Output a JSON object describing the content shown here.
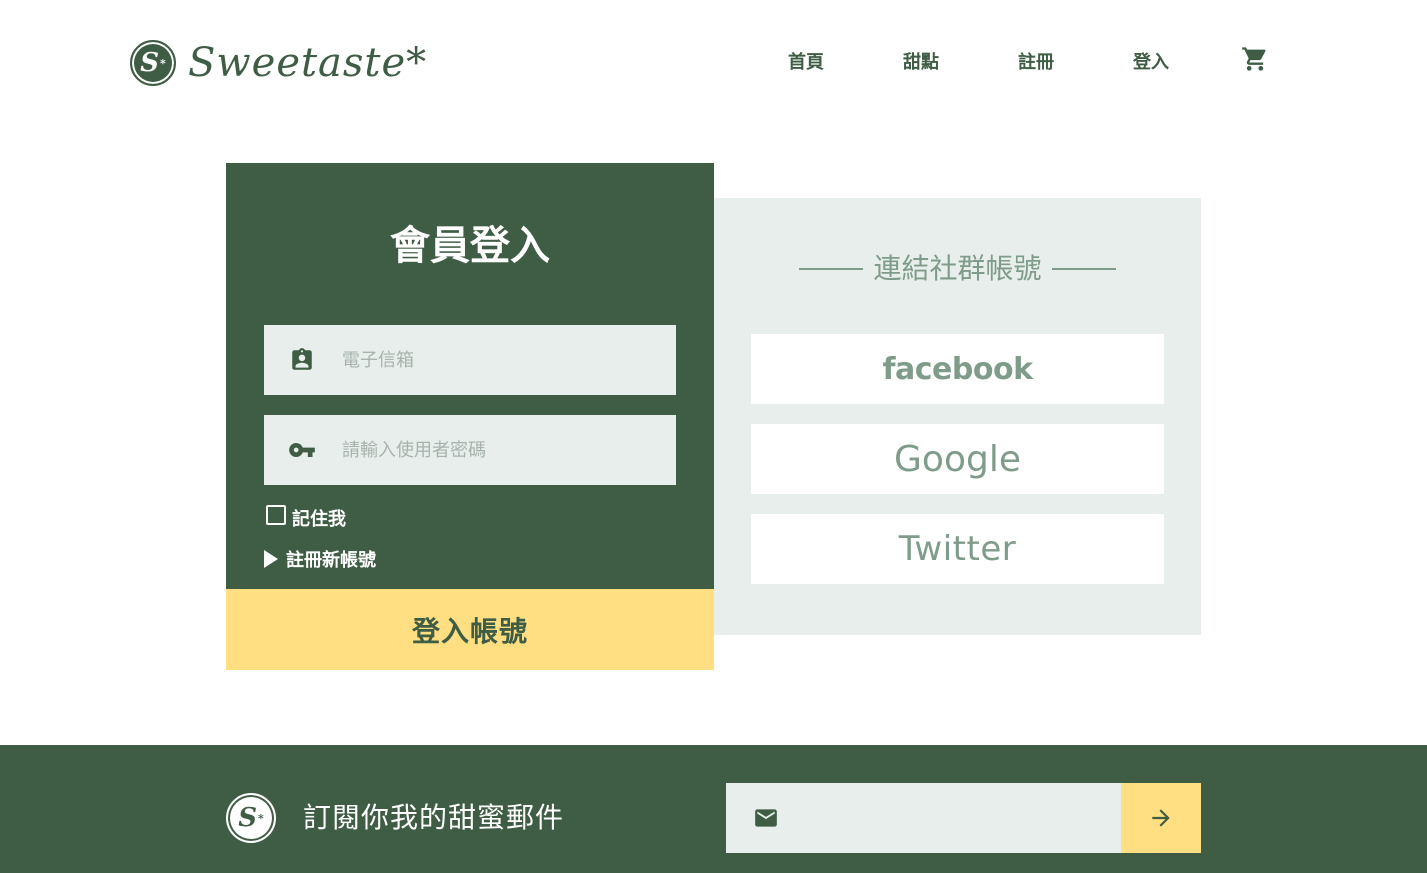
{
  "brand": {
    "logo_letter": "S",
    "logo_star": "*",
    "name": "Sweetaste*"
  },
  "nav": {
    "items": [
      {
        "label": "首頁"
      },
      {
        "label": "甜點"
      },
      {
        "label": "註冊"
      },
      {
        "label": "登入"
      }
    ],
    "cart_icon": "shopping-cart-icon"
  },
  "login": {
    "title": "會員登入",
    "email_placeholder": "電子信箱",
    "email_value": "",
    "password_placeholder": "請輸入使用者密碼",
    "password_value": "",
    "remember_label": "記住我",
    "remember_checked": false,
    "register_label": "註冊新帳號",
    "submit_label": "登入帳號"
  },
  "social": {
    "title": "連結社群帳號",
    "buttons": [
      {
        "label": "facebook"
      },
      {
        "label": "Google"
      },
      {
        "label": "Twitter"
      }
    ]
  },
  "footer": {
    "subscribe_text": "訂閱你我的甜蜜郵件",
    "email_value": "",
    "mail_icon": "mail-icon",
    "submit_icon": "arrow-right-icon"
  },
  "colors": {
    "primary": "#3f5c45",
    "light": "#e8eeeb",
    "accent": "#ffdf82",
    "muted": "#7f9c8a"
  }
}
